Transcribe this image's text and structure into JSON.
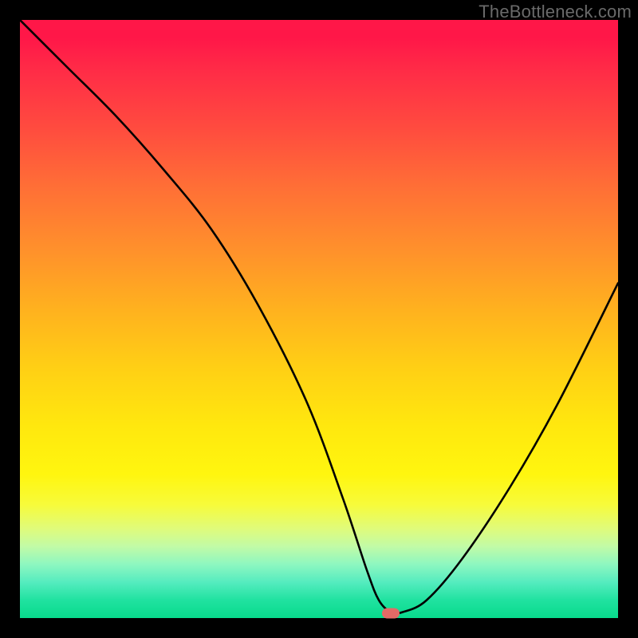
{
  "watermark": "TheBottleneck.com",
  "chart_data": {
    "type": "line",
    "title": "",
    "xlabel": "",
    "ylabel": "",
    "xlim": [
      0,
      100
    ],
    "ylim": [
      0,
      100
    ],
    "x": [
      0,
      8,
      16,
      24,
      32,
      40,
      48,
      54,
      58,
      60,
      62,
      64,
      68,
      74,
      82,
      90,
      100
    ],
    "values": [
      100,
      92,
      84,
      75,
      65,
      52,
      36,
      20,
      8,
      3,
      1,
      1,
      3,
      10,
      22,
      36,
      56
    ],
    "gradient_stops": [
      {
        "pos": 0,
        "color": "#ff1748"
      },
      {
        "pos": 3,
        "color": "#ff1748"
      },
      {
        "pos": 8,
        "color": "#ff2a47"
      },
      {
        "pos": 18,
        "color": "#ff4b3f"
      },
      {
        "pos": 28,
        "color": "#ff6f36"
      },
      {
        "pos": 38,
        "color": "#ff8f2c"
      },
      {
        "pos": 48,
        "color": "#ffb01f"
      },
      {
        "pos": 58,
        "color": "#ffcf15"
      },
      {
        "pos": 68,
        "color": "#ffe80e"
      },
      {
        "pos": 76,
        "color": "#fff60f"
      },
      {
        "pos": 81,
        "color": "#f7fb3a"
      },
      {
        "pos": 85,
        "color": "#e0fb7a"
      },
      {
        "pos": 88,
        "color": "#c2fba6"
      },
      {
        "pos": 91,
        "color": "#8ef7c0"
      },
      {
        "pos": 94,
        "color": "#55ecbf"
      },
      {
        "pos": 97,
        "color": "#20e2a0"
      },
      {
        "pos": 100,
        "color": "#08db8c"
      }
    ],
    "marker": {
      "x": 62,
      "y": 0.8,
      "color": "#e46a66"
    }
  }
}
